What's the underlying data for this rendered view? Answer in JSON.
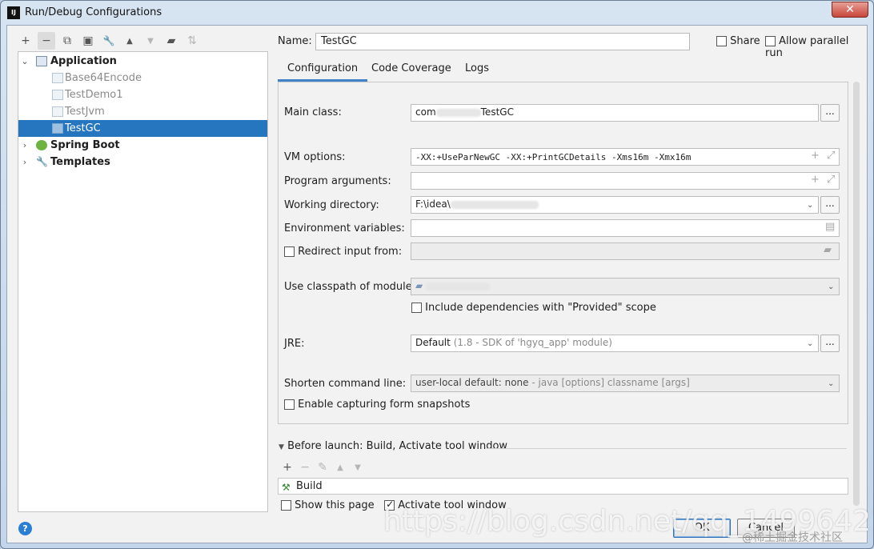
{
  "window": {
    "title": "Run/Debug Configurations",
    "icon_text": "IJ",
    "close_glyph": "✕"
  },
  "toolbar": {
    "items": [
      {
        "name": "add-icon",
        "glyph": "+"
      },
      {
        "name": "remove-icon",
        "glyph": "−"
      },
      {
        "name": "copy-icon",
        "glyph": "⧉"
      },
      {
        "name": "save-icon",
        "glyph": "▣"
      },
      {
        "name": "wrench-icon",
        "glyph": "🔧"
      },
      {
        "name": "move-up-icon",
        "glyph": "▲"
      },
      {
        "name": "move-down-icon",
        "glyph": "▼"
      },
      {
        "name": "folder-icon",
        "glyph": "▰"
      },
      {
        "name": "sort-icon",
        "glyph": "⇅"
      }
    ]
  },
  "tree": {
    "application": "Application",
    "children": [
      "Base64Encode",
      "TestDemo1",
      "TestJvm",
      "TestGC"
    ],
    "spring_boot": "Spring Boot",
    "templates": "Templates"
  },
  "form": {
    "name_label": "Name:",
    "name_value": "TestGC",
    "share_label": "Share",
    "allow_parallel_label": "Allow parallel run",
    "tabs": [
      "Configuration",
      "Code Coverage",
      "Logs"
    ],
    "main_class_label": "Main class:",
    "main_class_prefix": "com",
    "main_class_suffix": "TestGC",
    "vm_options_label": "VM options:",
    "vm_options_value": "-XX:+UseParNewGC -XX:+PrintGCDetails -Xms16m -Xmx16m",
    "program_args_label": "Program arguments:",
    "working_dir_label": "Working directory:",
    "working_dir_value": "F:\\idea\\",
    "env_vars_label": "Environment variables:",
    "redirect_label": "Redirect input from:",
    "classpath_label": "Use classpath of module:",
    "include_deps_label": "Include dependencies with \"Provided\" scope",
    "jre_label": "JRE:",
    "jre_value": "Default",
    "jre_detail": "(1.8 - SDK of 'hgyq_app' module)",
    "shorten_label": "Shorten command line:",
    "shorten_value": "user-local default: none",
    "shorten_detail": "- java [options] classname [args]",
    "enable_snapshots_label": "Enable capturing form snapshots",
    "dots": "..."
  },
  "before_launch": {
    "title": "Before launch: Build, Activate tool window",
    "build_label": "Build",
    "show_page_label": "Show this page",
    "activate_label": "Activate tool window"
  },
  "buttons": {
    "ok": "OK",
    "cancel": "Cancel",
    "help": "?"
  },
  "watermark": {
    "url": "https://blog.csdn.net/qq_14996421",
    "site": "@稀土掘金技术社区"
  }
}
